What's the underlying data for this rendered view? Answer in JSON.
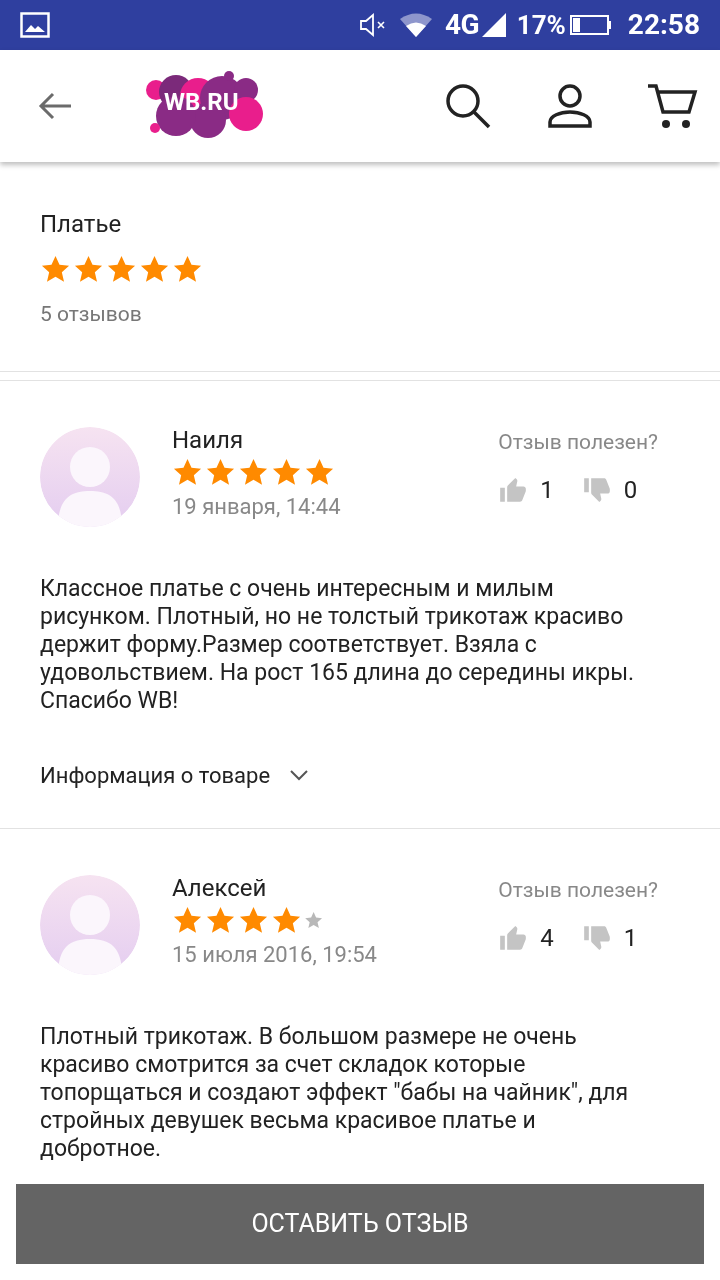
{
  "status_bar": {
    "network": "4G",
    "battery": "17%",
    "time": "22:58"
  },
  "header": {
    "logo": "WB.RU"
  },
  "product": {
    "title": "Платье",
    "stars": 5,
    "reviews_count": "5 отзывов"
  },
  "reviews": [
    {
      "author": "Наиля",
      "stars": 5,
      "date": "19 января, 14:44",
      "helpful_label": "Отзыв полезен?",
      "likes": "1",
      "dislikes": "0",
      "text": "Классное платье с очень интересным и милым рисунком. Плотный, но не толстый трикотаж красиво держит форму.Размер соответствует. Взяла с удовольствием. На рост 165 длина до середины икры. Спасибо WB!",
      "info_label": "Информация о товаре"
    },
    {
      "author": "Алексей",
      "stars": 4,
      "date": "15 июля 2016, 19:54",
      "helpful_label": "Отзыв полезен?",
      "likes": "4",
      "dislikes": "1",
      "text": "Плотный трикотаж. В большом размере не очень красиво смотрится за счет складок которые топорщаться и создают эффект \"бабы на чайник\", для стройных девушек весьма красивое платье и добротное."
    }
  ],
  "leave_review_button": "ОСТАВИТЬ ОТЗЫВ"
}
